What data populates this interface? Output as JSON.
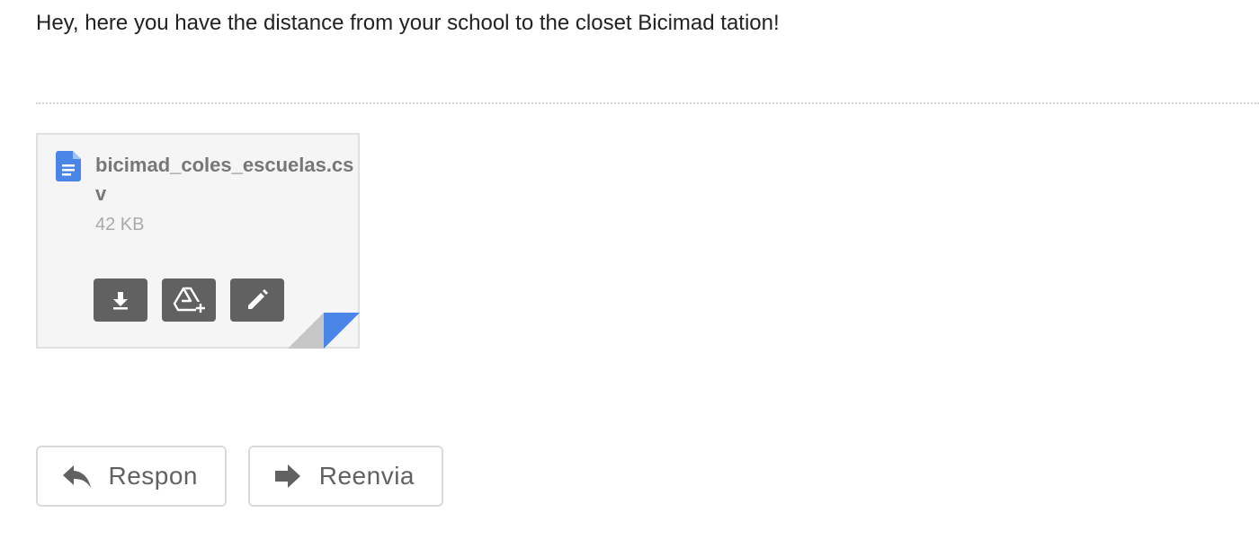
{
  "message": {
    "body": "Hey, here you have the distance from your school to the closet Bicimad tation!"
  },
  "attachment": {
    "file_name": "bicimad_coles_escuelas.csv",
    "file_size": "42 KB",
    "icon": "document-icon",
    "accent_color": "#4a86e8",
    "actions": [
      {
        "name": "download",
        "icon": "download-icon"
      },
      {
        "name": "save-to-drive",
        "icon": "drive-add-icon"
      },
      {
        "name": "edit",
        "icon": "pencil-icon"
      }
    ]
  },
  "reply_actions": {
    "respond_label": "Respon",
    "forward_label": "Reenvia"
  }
}
